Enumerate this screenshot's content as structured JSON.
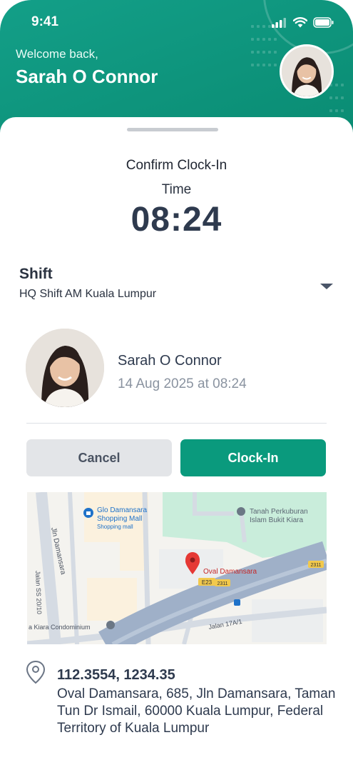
{
  "status_bar": {
    "time": "9:41"
  },
  "header": {
    "welcome": "Welcome back,",
    "user_name": "Sarah O Connor"
  },
  "confirm": {
    "title": "Confirm Clock-In",
    "time_label": "Time",
    "time_value": "08:24"
  },
  "shift": {
    "label": "Shift",
    "value": "HQ Shift AM Kuala Lumpur"
  },
  "profile": {
    "name": "Sarah O Connor",
    "datetime": "14 Aug 2025 at 08:24"
  },
  "actions": {
    "cancel_label": "Cancel",
    "clockin_label": "Clock-In"
  },
  "map": {
    "labels": {
      "mall_name": "Glo Damansara Shopping Mall",
      "mall_name_line1": "Glo Damansara",
      "mall_name_line2": "Shopping Mall",
      "mall_type": "Shopping mall",
      "cemetery_line1": "Tanah Perkuburan",
      "cemetery_line2": "Islam Bukit Kiara",
      "road_jln_damansara": "Jln Damansara",
      "road_ss20": "Jalan SS 20/10",
      "pin_label": "Oval Damansara",
      "condo": "a Kiara Condominium",
      "road_17a": "Jalan 17A/1",
      "route_e23": "E23",
      "route_2311": "2311"
    },
    "colors": {
      "park": "#c9eddb",
      "road": "#d5dbe3",
      "highway": "#9fb0c8",
      "pin": "#e53935",
      "poi": "#1f72c9"
    }
  },
  "location": {
    "coordinates": "112.3554, 1234.35",
    "address": "Oval Damansara, 685, Jln Damansara, Taman Tun Dr Ismail, 60000 Kuala Lumpur, Federal Territory of Kuala Lumpur"
  },
  "icons": {
    "signal": "signal-icon",
    "wifi": "wifi-icon",
    "battery": "battery-icon",
    "dropdown": "chevron-down-icon",
    "location": "location-pin-icon"
  },
  "theme": {
    "primary": "#0a9a7d",
    "text_dark": "#2e3a4e",
    "text_muted": "#8a93a0"
  }
}
